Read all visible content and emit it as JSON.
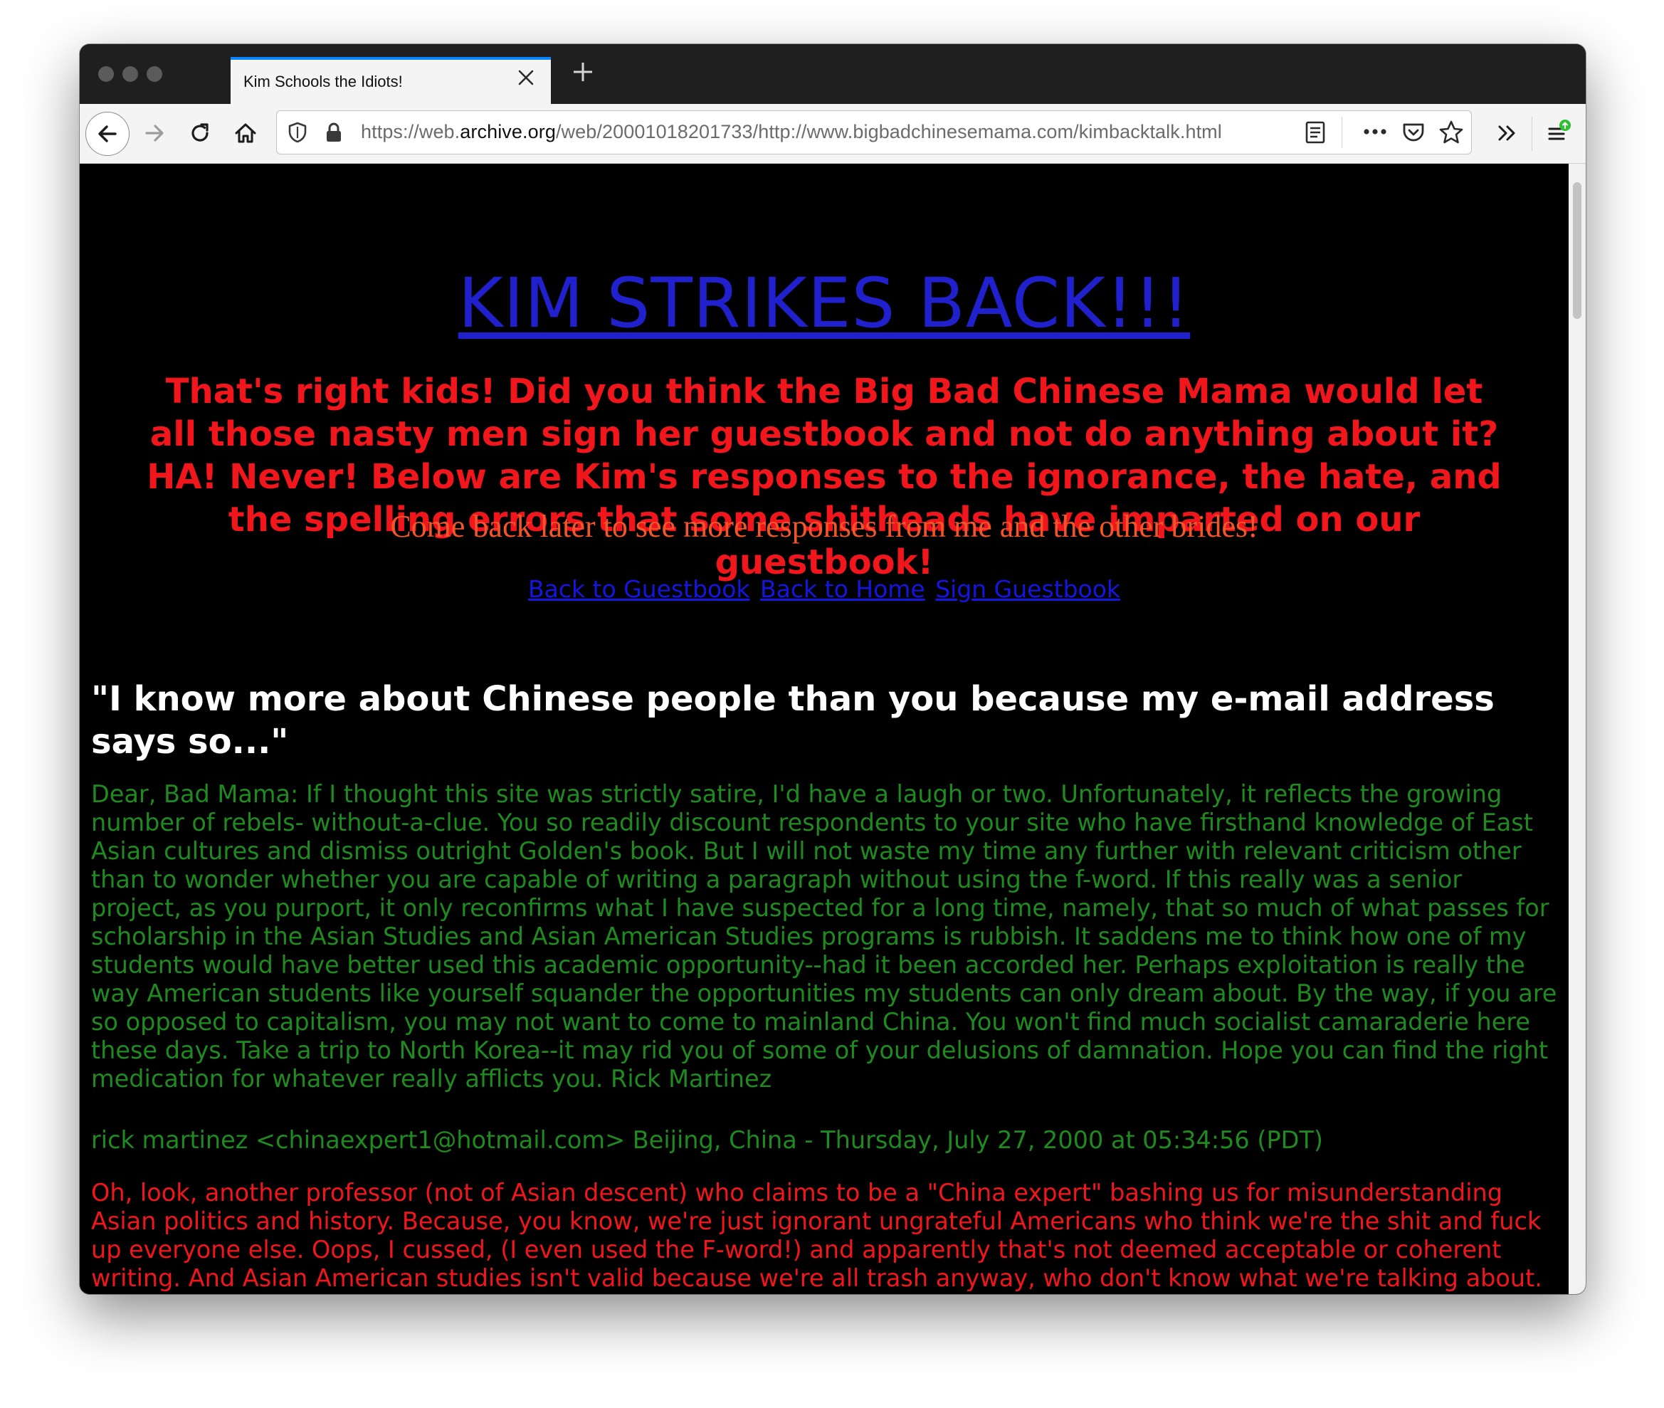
{
  "browser": {
    "tab_title": "Kim Schools the Idiots!",
    "url_prefix": "https://web.",
    "url_domain": "archive.org",
    "url_path": "/web/20001018201733/http://www.bigbadchinesemama.com/kimbacktalk.html",
    "icons": [
      "close-icon",
      "plus-icon",
      "back-arrow-icon",
      "forward-arrow-icon",
      "reload-icon",
      "home-icon",
      "shield-icon",
      "lock-icon",
      "reader-view-icon",
      "more-dots-icon",
      "pocket-icon",
      "star-icon",
      "overflow-chevrons-icon",
      "hamburger-menu-icon"
    ],
    "colors": {
      "tab_accent": "#0a84ff",
      "update_badge": "#2fbf30"
    }
  },
  "page": {
    "title": "KIM STRIKES BACK!!!",
    "intro": "That's right kids! Did you think the Big Bad Chinese Mama would let all those nasty men sign her guestbook and not do anything about it? HA! Never! Below are Kim's responses to the ignorance, the hate, and the spelling errors that some shitheads have imparted on our guestbook!",
    "come_back": "Come back later to see more responses from me and the other brides!",
    "links": {
      "back_to_guestbook": "Back to Guestbook",
      "back_to_home": "Back to Home",
      "sign_guestbook": "Sign Guestbook"
    },
    "colors": {
      "title": "#2020cc",
      "intro": "#f0161c",
      "come_back": "#f2552a",
      "message": "#1f8a1f",
      "response": "#f0161c"
    }
  },
  "entry": {
    "heading": "\"I know more about Chinese people than you because my e-mail address says so...\"",
    "message": "Dear, Bad Mama: If I thought this site was strictly satire, I'd have a laugh or two. Unfortunately, it reflects the growing number of rebels- without-a-clue. You so readily discount respondents to your site who have firsthand knowledge of East Asian cultures and dismiss outright Golden's book. But I will not waste my time any further with relevant criticism other than to wonder whether you are capable of writing a paragraph without using the f-word. If this really was a senior project, as you purport, it only reconfirms what I have suspected for a long time, namely, that so much of what passes for scholarship in the Asian Studies and Asian American Studies programs is rubbish. It saddens me to think how one of my students would have better used this academic opportunity--had it been accorded her. Perhaps exploitation is really the way American students like yourself squander the opportunities my students can only dream about. By the way, if you are so opposed to capitalism, you may not want to come to mainland China. You won't find much socialist camaraderie here these days. Take a trip to North Korea--it may rid you of some of your delusions of damnation. Hope you can find the right medication for whatever really afflicts you. Rick Martinez",
    "signature": "rick martinez <chinaexpert1@hotmail.com> Beijing, China - Thursday, July 27, 2000 at 05:34:56 (PDT)",
    "response": "Oh, look, another professor (not of Asian descent) who claims to be a \"China expert\" bashing us for misunderstanding Asian politics and history. Because, you know, we're just ignorant ungrateful Americans who think we're the shit and fuck up everyone else. Oops, I cussed, (I even used the F-word!) and apparently that's not deemed acceptable or coherent writing. And Asian American studies isn't valid because we're all trash anyway, who don't know what we're talking about. Capitalism-"
  }
}
